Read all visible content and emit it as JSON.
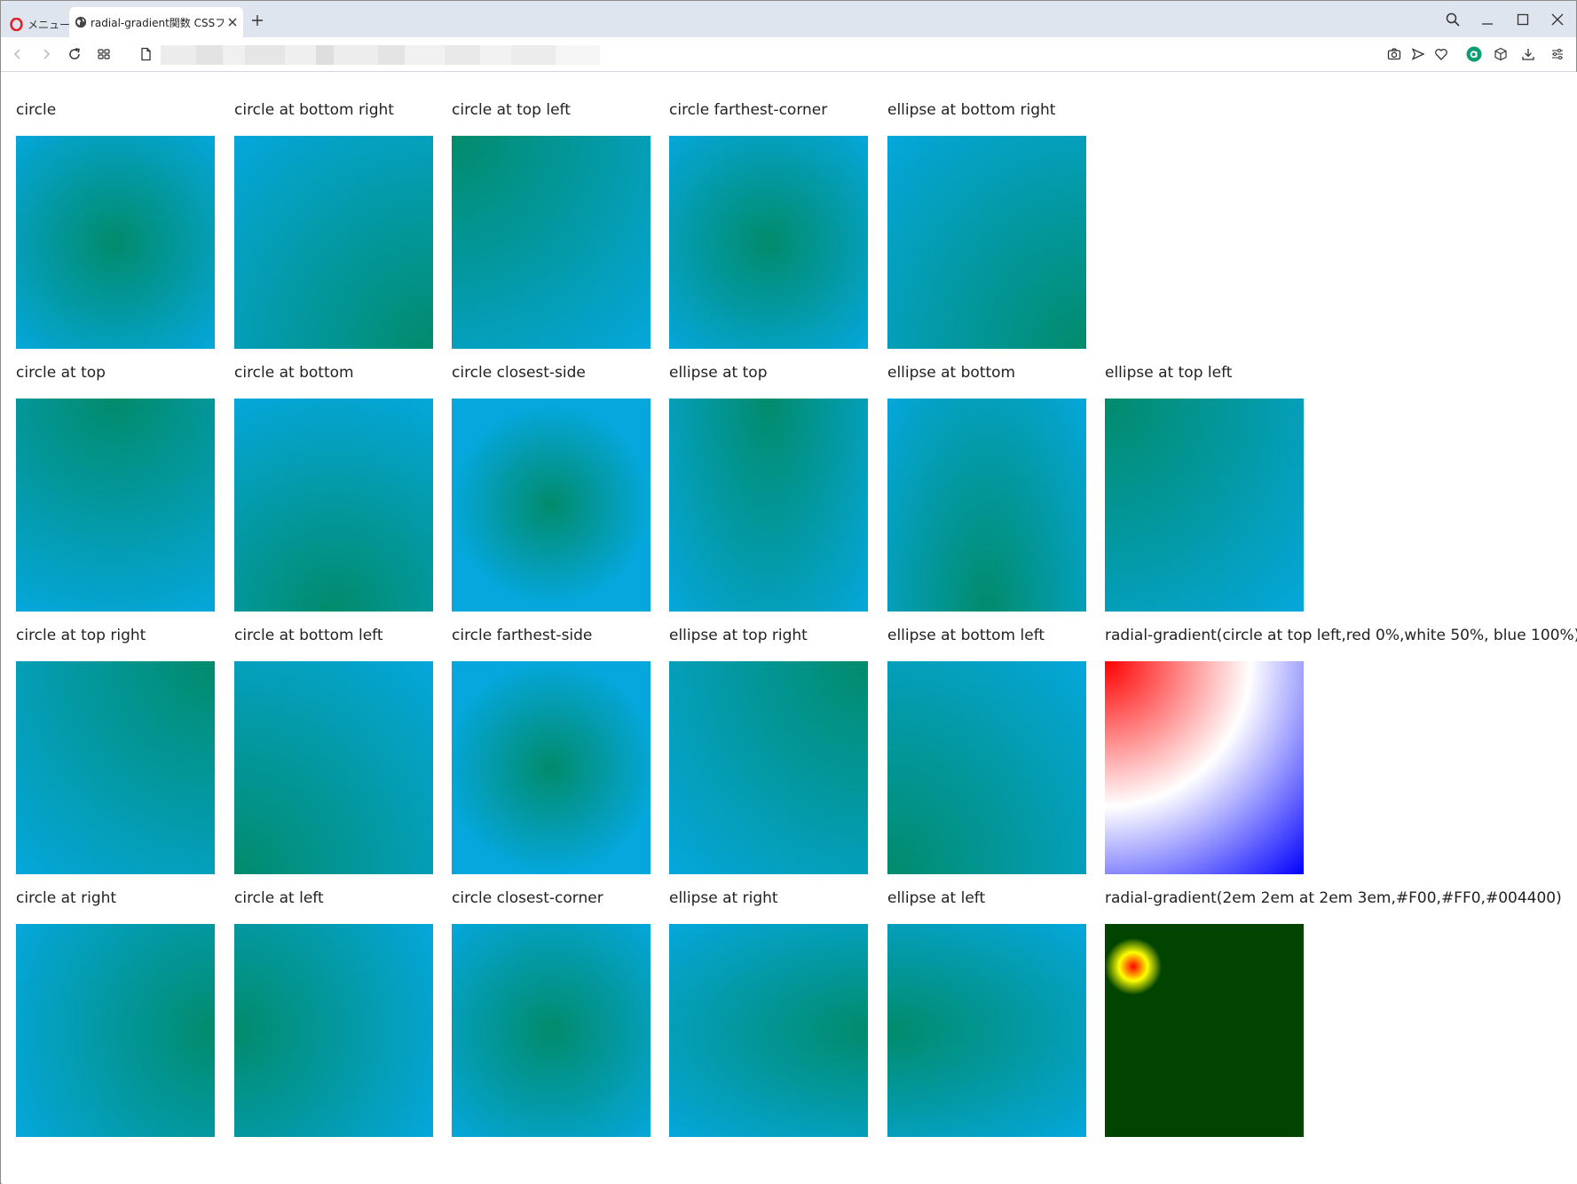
{
  "browser": {
    "menu_label": "メニュー",
    "tab_title": "radial-gradient関数 CSSフォ",
    "colors": {
      "tabbar": "#dfe5ee",
      "accent_red": "#e0232e",
      "badge_green": "#0d9d75"
    }
  },
  "grid": {
    "colors": {
      "from": "#018b6b",
      "to": "#05a7dc"
    },
    "rows": [
      [
        {
          "label": "circle",
          "gradient": "radial-gradient(circle, #018b6b, #05a7dc)"
        },
        {
          "label": "circle at bottom right",
          "gradient": "radial-gradient(circle at bottom right, #018b6b, #05a7dc)"
        },
        {
          "label": "circle at top left",
          "gradient": "radial-gradient(circle at top left, #018b6b, #05a7dc)"
        },
        {
          "label": "circle farthest-corner",
          "gradient": "radial-gradient(circle farthest-corner, #018b6b, #05a7dc)"
        },
        {
          "label": "ellipse at bottom right",
          "gradient": "radial-gradient(ellipse at bottom right, #018b6b, #05a7dc)"
        }
      ],
      [
        {
          "label": "circle at top",
          "gradient": "radial-gradient(circle at top, #018b6b, #05a7dc)"
        },
        {
          "label": "circle at bottom",
          "gradient": "radial-gradient(circle at bottom, #018b6b, #05a7dc)"
        },
        {
          "label": "circle closest-side",
          "gradient": "radial-gradient(circle closest-side, #018b6b, #05a7dc)"
        },
        {
          "label": "ellipse at top",
          "gradient": "radial-gradient(ellipse at top, #018b6b, #05a7dc)"
        },
        {
          "label": "ellipse at bottom",
          "gradient": "radial-gradient(ellipse at bottom, #018b6b, #05a7dc)"
        },
        {
          "label": "ellipse at top left",
          "gradient": "radial-gradient(ellipse at top left, #018b6b, #05a7dc)"
        }
      ],
      [
        {
          "label": "circle at top right",
          "gradient": "radial-gradient(circle at top right, #018b6b, #05a7dc)"
        },
        {
          "label": "circle at bottom left",
          "gradient": "radial-gradient(circle at bottom left, #018b6b, #05a7dc)"
        },
        {
          "label": "circle farthest-side",
          "gradient": "radial-gradient(circle farthest-side, #018b6b, #05a7dc)"
        },
        {
          "label": "ellipse at top right",
          "gradient": "radial-gradient(ellipse at top right, #018b6b, #05a7dc)"
        },
        {
          "label": "ellipse at bottom left",
          "gradient": "radial-gradient(ellipse at bottom left, #018b6b, #05a7dc)"
        },
        {
          "label": "radial-gradient(circle at top left,red 0%,white 50%, blue 100%)",
          "gradient": "radial-gradient(circle at top left, red 0%, white 50%, blue 100%)"
        }
      ],
      [
        {
          "label": "circle at right",
          "gradient": "radial-gradient(circle at right, #018b6b, #05a7dc)"
        },
        {
          "label": "circle at left",
          "gradient": "radial-gradient(circle at left, #018b6b, #05a7dc)"
        },
        {
          "label": "circle closest-corner",
          "gradient": "radial-gradient(circle closest-corner, #018b6b, #05a7dc)"
        },
        {
          "label": "ellipse at right",
          "gradient": "radial-gradient(ellipse at right, #018b6b, #05a7dc)"
        },
        {
          "label": "ellipse at left",
          "gradient": "radial-gradient(ellipse at left, #018b6b, #05a7dc)"
        },
        {
          "label": "radial-gradient(2em 2em at 2em 3em,#F00,#FF0,#004400)",
          "gradient": "radial-gradient(2em 2em at 2em 3em, #F00, #FF0, #004400)"
        }
      ]
    ]
  }
}
